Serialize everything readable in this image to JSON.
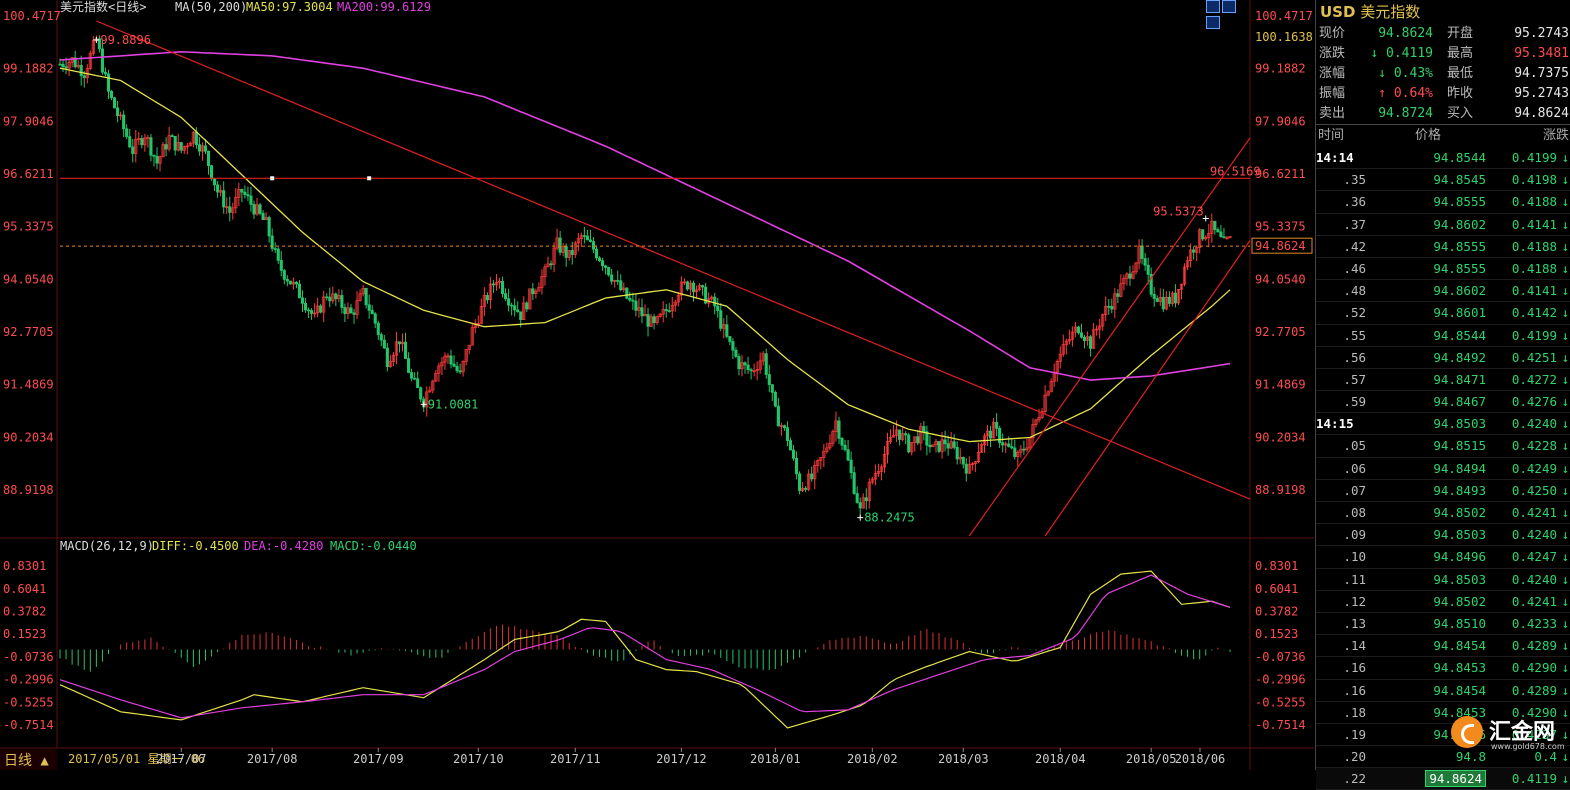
{
  "chart_data": [
    {
      "type": "candlestick",
      "title": "美元指数<日线>",
      "indicator_label": "MA(50,200)",
      "ma50_label": "MA50:97.3004",
      "ma200_label": "MA200:99.6129",
      "y_ticks": [
        "100.4717",
        "99.1882",
        "97.9046",
        "96.6211",
        "95.3375",
        "94.0540",
        "92.7705",
        "91.4869",
        "90.2034",
        "88.9198"
      ],
      "y_top_right": "100.1638",
      "ylim": [
        87.8,
        100.4717
      ],
      "x_ticks": [
        "2017/07",
        "2017/08",
        "2017/09",
        "2017/10",
        "2017/11",
        "2017/12",
        "2018/01",
        "2018/02",
        "2018/03",
        "2018/04",
        "2018/05",
        "2018/06"
      ],
      "x_start_label": "2017/05/01  星期一 06",
      "annotations": {
        "high1": "99.8896",
        "low1": "91.0081",
        "low2": "88.2475",
        "high2": "95.5373",
        "hline_label": "96.5169",
        "last_price": "94.8624"
      },
      "price_anchors": [
        [
          0,
          99.3
        ],
        [
          4,
          99.4
        ],
        [
          8,
          99.1
        ],
        [
          12,
          99.9
        ],
        [
          16,
          98.6
        ],
        [
          20,
          97.9
        ],
        [
          24,
          97.2
        ],
        [
          28,
          97.6
        ],
        [
          32,
          96.9
        ],
        [
          36,
          97.5
        ],
        [
          40,
          97.2
        ],
        [
          44,
          97.6
        ],
        [
          48,
          97.1
        ],
        [
          52,
          96.2
        ],
        [
          56,
          95.7
        ],
        [
          60,
          96.2
        ],
        [
          64,
          95.8
        ],
        [
          68,
          95.4
        ],
        [
          72,
          94.4
        ],
        [
          76,
          94.0
        ],
        [
          80,
          93.6
        ],
        [
          84,
          93.1
        ],
        [
          88,
          93.7
        ],
        [
          92,
          93.5
        ],
        [
          96,
          93.2
        ],
        [
          100,
          93.7
        ],
        [
          104,
          93.0
        ],
        [
          108,
          92.1
        ],
        [
          112,
          92.6
        ],
        [
          116,
          91.6
        ],
        [
          120,
          91.1
        ],
        [
          124,
          91.9
        ],
        [
          128,
          92.2
        ],
        [
          132,
          91.7
        ],
        [
          136,
          92.8
        ],
        [
          140,
          93.5
        ],
        [
          144,
          94.1
        ],
        [
          148,
          93.6
        ],
        [
          152,
          93.2
        ],
        [
          156,
          93.8
        ],
        [
          160,
          94.2
        ],
        [
          164,
          94.9
        ],
        [
          168,
          94.6
        ],
        [
          172,
          95.1
        ],
        [
          176,
          94.8
        ],
        [
          180,
          94.4
        ],
        [
          184,
          93.9
        ],
        [
          188,
          93.5
        ],
        [
          192,
          93.2
        ],
        [
          196,
          92.9
        ],
        [
          200,
          93.3
        ],
        [
          204,
          93.8
        ],
        [
          208,
          94.0
        ],
        [
          212,
          93.7
        ],
        [
          216,
          93.4
        ],
        [
          220,
          92.6
        ],
        [
          224,
          92.0
        ],
        [
          228,
          91.8
        ],
        [
          232,
          92.2
        ],
        [
          236,
          90.8
        ],
        [
          240,
          90.2
        ],
        [
          244,
          89.0
        ],
        [
          248,
          89.2
        ],
        [
          252,
          89.8
        ],
        [
          256,
          90.6
        ],
        [
          260,
          89.6
        ],
        [
          264,
          88.4
        ],
        [
          268,
          89.2
        ],
        [
          272,
          89.8
        ],
        [
          276,
          90.4
        ],
        [
          280,
          90.0
        ],
        [
          284,
          90.3
        ],
        [
          288,
          89.9
        ],
        [
          292,
          90.1
        ],
        [
          296,
          89.8
        ],
        [
          300,
          89.4
        ],
        [
          304,
          90.1
        ],
        [
          308,
          90.4
        ],
        [
          312,
          90.0
        ],
        [
          316,
          89.7
        ],
        [
          320,
          90.2
        ],
        [
          324,
          91.0
        ],
        [
          328,
          91.9
        ],
        [
          332,
          92.5
        ],
        [
          336,
          92.9
        ],
        [
          340,
          92.5
        ],
        [
          344,
          93.2
        ],
        [
          348,
          93.6
        ],
        [
          352,
          94.1
        ],
        [
          356,
          94.7
        ],
        [
          360,
          93.8
        ],
        [
          364,
          93.5
        ],
        [
          368,
          93.6
        ],
        [
          372,
          94.6
        ],
        [
          376,
          95.1
        ],
        [
          380,
          95.3
        ],
        [
          384,
          94.9
        ],
        [
          386,
          95.0
        ]
      ],
      "ma50_anchors": [
        [
          0,
          99.2
        ],
        [
          20,
          98.9
        ],
        [
          40,
          98.0
        ],
        [
          60,
          96.6
        ],
        [
          80,
          95.2
        ],
        [
          100,
          94.0
        ],
        [
          120,
          93.3
        ],
        [
          140,
          92.9
        ],
        [
          160,
          93.0
        ],
        [
          180,
          93.6
        ],
        [
          200,
          93.8
        ],
        [
          220,
          93.4
        ],
        [
          240,
          92.1
        ],
        [
          260,
          91.0
        ],
        [
          280,
          90.4
        ],
        [
          300,
          90.1
        ],
        [
          320,
          90.2
        ],
        [
          340,
          90.9
        ],
        [
          360,
          92.2
        ],
        [
          380,
          93.4
        ],
        [
          386,
          93.8
        ]
      ],
      "ma200_anchors": [
        [
          0,
          99.4
        ],
        [
          40,
          99.6
        ],
        [
          70,
          99.5
        ],
        [
          100,
          99.2
        ],
        [
          140,
          98.5
        ],
        [
          180,
          97.3
        ],
        [
          220,
          95.9
        ],
        [
          260,
          94.5
        ],
        [
          300,
          92.8
        ],
        [
          320,
          91.9
        ],
        [
          340,
          91.6
        ],
        [
          360,
          91.7
        ],
        [
          386,
          92.0
        ]
      ],
      "macd_title": "MACD(26,12,9)",
      "diff_label": "DIFF:-0.4500",
      "dea_label": "DEA:-0.4280",
      "macd_label": "MACD:-0.0440",
      "macd_ticks": [
        "0.8301",
        "0.6041",
        "0.3782",
        "0.1523",
        "-0.0736",
        "-0.2996",
        "-0.5255",
        "-0.7514"
      ],
      "macd_ylim": [
        -0.95,
        0.95
      ],
      "diff_anchors": [
        [
          0,
          -0.35
        ],
        [
          20,
          -0.62
        ],
        [
          40,
          -0.7
        ],
        [
          60,
          -0.5
        ],
        [
          64,
          -0.45
        ],
        [
          80,
          -0.52
        ],
        [
          100,
          -0.38
        ],
        [
          120,
          -0.48
        ],
        [
          140,
          -0.1
        ],
        [
          150,
          0.1
        ],
        [
          165,
          0.18
        ],
        [
          172,
          0.3
        ],
        [
          180,
          0.28
        ],
        [
          190,
          -0.1
        ],
        [
          200,
          -0.2
        ],
        [
          210,
          -0.22
        ],
        [
          225,
          -0.35
        ],
        [
          240,
          -0.78
        ],
        [
          255,
          -0.65
        ],
        [
          265,
          -0.55
        ],
        [
          275,
          -0.3
        ],
        [
          285,
          -0.18
        ],
        [
          300,
          -0.02
        ],
        [
          315,
          -0.12
        ],
        [
          330,
          0.02
        ],
        [
          340,
          0.55
        ],
        [
          350,
          0.75
        ],
        [
          360,
          0.78
        ],
        [
          370,
          0.45
        ],
        [
          380,
          0.48
        ],
        [
          386,
          0.42
        ]
      ],
      "dea_anchors": [
        [
          0,
          -0.3
        ],
        [
          20,
          -0.5
        ],
        [
          40,
          -0.68
        ],
        [
          60,
          -0.58
        ],
        [
          80,
          -0.52
        ],
        [
          100,
          -0.45
        ],
        [
          120,
          -0.45
        ],
        [
          140,
          -0.2
        ],
        [
          150,
          -0.02
        ],
        [
          165,
          0.1
        ],
        [
          175,
          0.22
        ],
        [
          185,
          0.18
        ],
        [
          200,
          -0.1
        ],
        [
          215,
          -0.2
        ],
        [
          230,
          -0.4
        ],
        [
          245,
          -0.62
        ],
        [
          260,
          -0.6
        ],
        [
          275,
          -0.4
        ],
        [
          290,
          -0.25
        ],
        [
          305,
          -0.1
        ],
        [
          320,
          -0.06
        ],
        [
          335,
          0.12
        ],
        [
          345,
          0.55
        ],
        [
          360,
          0.74
        ],
        [
          372,
          0.55
        ],
        [
          386,
          0.42
        ]
      ],
      "macd_hist_anchors": [
        [
          0,
          -0.08
        ],
        [
          10,
          -0.22
        ],
        [
          20,
          0.05
        ],
        [
          30,
          0.12
        ],
        [
          45,
          -0.18
        ],
        [
          60,
          0.14
        ],
        [
          70,
          0.18
        ],
        [
          80,
          0.06
        ],
        [
          95,
          -0.05
        ],
        [
          110,
          0.02
        ],
        [
          125,
          -0.1
        ],
        [
          135,
          0.1
        ],
        [
          145,
          0.25
        ],
        [
          155,
          0.2
        ],
        [
          165,
          0.12
        ],
        [
          175,
          -0.05
        ],
        [
          185,
          -0.12
        ],
        [
          195,
          0.1
        ],
        [
          205,
          -0.08
        ],
        [
          215,
          -0.04
        ],
        [
          225,
          -0.18
        ],
        [
          235,
          -0.2
        ],
        [
          245,
          -0.06
        ],
        [
          255,
          0.1
        ],
        [
          265,
          0.14
        ],
        [
          275,
          0.05
        ],
        [
          285,
          0.2
        ],
        [
          295,
          0.1
        ],
        [
          305,
          -0.05
        ],
        [
          315,
          0.03
        ],
        [
          325,
          -0.02
        ],
        [
          335,
          0.1
        ],
        [
          345,
          0.2
        ],
        [
          355,
          0.12
        ],
        [
          365,
          0.02
        ],
        [
          375,
          -0.12
        ],
        [
          382,
          0.02
        ],
        [
          386,
          -0.02
        ]
      ]
    }
  ],
  "quote": {
    "symbol": "USD",
    "name": "美元指数",
    "rows": [
      {
        "l1": "现价",
        "v1": "94.8624",
        "c1": "green",
        "l2": "开盘",
        "v2": "95.2743",
        "c2": "white"
      },
      {
        "l1": "涨跌",
        "v1": "↓ 0.4119",
        "c1": "green",
        "l2": "最高",
        "v2": "95.3481",
        "c2": "red"
      },
      {
        "l1": "涨幅",
        "v1": "↓ 0.43%",
        "c1": "green",
        "l2": "最低",
        "v2": "94.7375",
        "c2": "white"
      },
      {
        "l1": "振幅",
        "v1": "↑ 0.64%",
        "c1": "red",
        "l2": "昨收",
        "v2": "95.2743",
        "c2": "white"
      },
      {
        "l1": "卖出",
        "v1": "94.8724",
        "c1": "green",
        "l2": "买入",
        "v2": "94.8624",
        "c2": "white"
      }
    ]
  },
  "ticks": {
    "headers": [
      "时间",
      "价格",
      "涨跌"
    ],
    "rows": [
      {
        "t": "14:14",
        "major": true,
        "p": "94.8544",
        "c": "0.4199"
      },
      {
        "t": ".35",
        "p": "94.8545",
        "c": "0.4198"
      },
      {
        "t": ".36",
        "p": "94.8555",
        "c": "0.4188"
      },
      {
        "t": ".37",
        "p": "94.8602",
        "c": "0.4141"
      },
      {
        "t": ".42",
        "p": "94.8555",
        "c": "0.4188"
      },
      {
        "t": ".46",
        "p": "94.8555",
        "c": "0.4188"
      },
      {
        "t": ".48",
        "p": "94.8602",
        "c": "0.4141"
      },
      {
        "t": ".52",
        "p": "94.8601",
        "c": "0.4142"
      },
      {
        "t": ".55",
        "p": "94.8544",
        "c": "0.4199"
      },
      {
        "t": ".56",
        "p": "94.8492",
        "c": "0.4251"
      },
      {
        "t": ".57",
        "p": "94.8471",
        "c": "0.4272"
      },
      {
        "t": ".59",
        "p": "94.8467",
        "c": "0.4276"
      },
      {
        "t": "14:15",
        "major": true,
        "p": "94.8503",
        "c": "0.4240"
      },
      {
        "t": ".05",
        "p": "94.8515",
        "c": "0.4228"
      },
      {
        "t": ".06",
        "p": "94.8494",
        "c": "0.4249"
      },
      {
        "t": ".07",
        "p": "94.8493",
        "c": "0.4250"
      },
      {
        "t": ".08",
        "p": "94.8502",
        "c": "0.4241"
      },
      {
        "t": ".09",
        "p": "94.8503",
        "c": "0.4240"
      },
      {
        "t": ".10",
        "p": "94.8496",
        "c": "0.4247"
      },
      {
        "t": ".11",
        "p": "94.8503",
        "c": "0.4240"
      },
      {
        "t": ".12",
        "p": "94.8502",
        "c": "0.4241"
      },
      {
        "t": ".13",
        "p": "94.8510",
        "c": "0.4233"
      },
      {
        "t": ".14",
        "p": "94.8454",
        "c": "0.4289"
      },
      {
        "t": ".16",
        "p": "94.8453",
        "c": "0.4290"
      },
      {
        "t": ".16",
        "p": "94.8454",
        "c": "0.4289"
      },
      {
        "t": ".18",
        "p": "94.8453",
        "c": "0.4290"
      },
      {
        "t": ".19",
        "p": "94.8506",
        "c": "0.4237"
      },
      {
        "t": ".20",
        "p": "94.8",
        "c": "0.4"
      },
      {
        "t": ".22",
        "p": "94.8624",
        "c": "0.4119",
        "last": true
      }
    ]
  },
  "timeframe_button": "日线 ▲",
  "logo": {
    "name": "汇金网",
    "url": "www.gold678.com"
  }
}
